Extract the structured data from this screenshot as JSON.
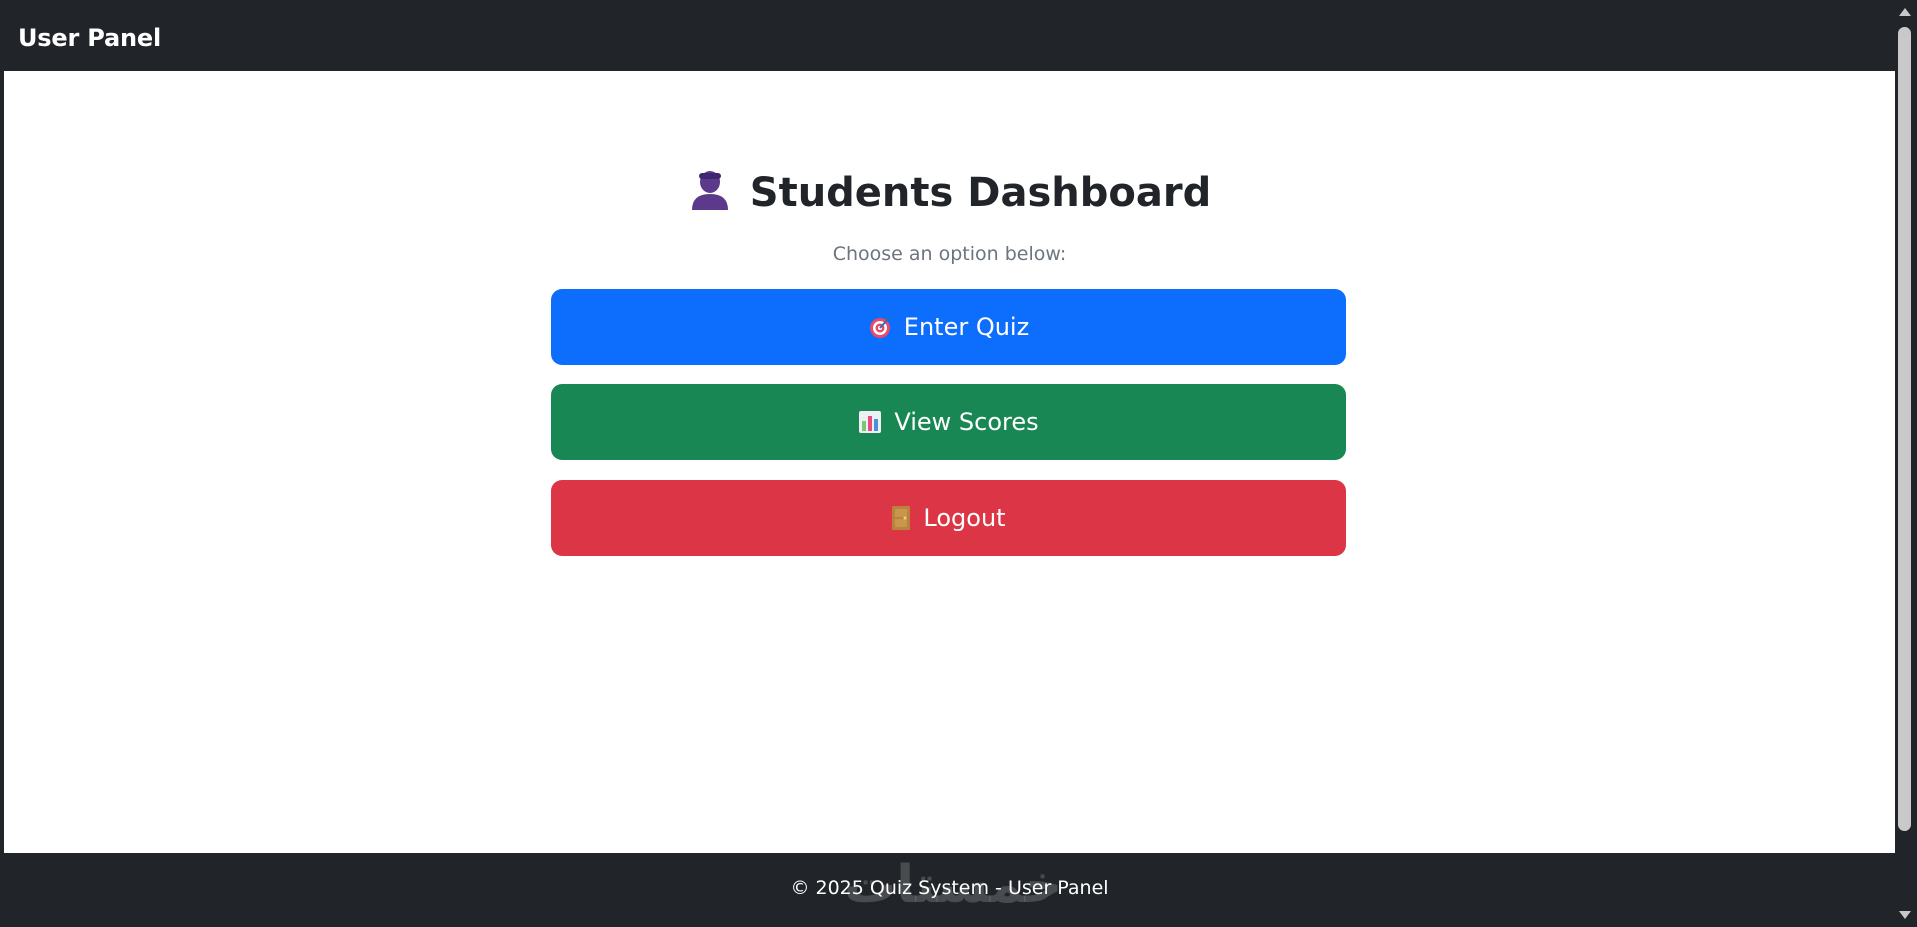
{
  "navbar": {
    "brand": "User Panel"
  },
  "main": {
    "heading": "Students Dashboard",
    "heading_icon": "student-icon",
    "subtitle": "Choose an option below:",
    "buttons": [
      {
        "label": "Enter Quiz",
        "icon": "target-icon",
        "color": "#0d6efd"
      },
      {
        "label": "View Scores",
        "icon": "bar-chart-icon",
        "color": "#198754"
      },
      {
        "label": "Logout",
        "icon": "door-icon",
        "color": "#dc3545"
      }
    ]
  },
  "footer": {
    "text": "© 2025 Quiz System - User Panel",
    "watermark": "خمستات"
  },
  "colors": {
    "navbar_bg": "#212529",
    "page_bg": "#ffffff",
    "primary": "#0d6efd",
    "success": "#198754",
    "danger": "#dc3545"
  }
}
